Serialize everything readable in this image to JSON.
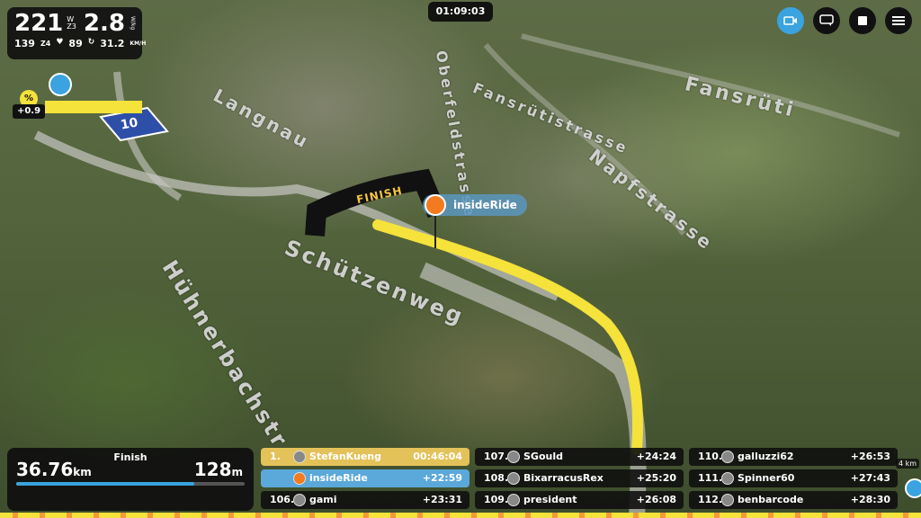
{
  "stats": {
    "power": "221",
    "power_unit": "W",
    "zone": "Z3",
    "wkg": "2.8",
    "wkg_unit": "W/kg",
    "heart_rate": "139",
    "hr_zone": "Z4",
    "cadence": "89",
    "speed": "31.2",
    "speed_unit": "KM/H"
  },
  "grade": {
    "symbol": "%",
    "value": "+0.9"
  },
  "clock": "01:09:03",
  "map": {
    "streets": [
      "Langnau",
      "Oberfeldstrasse",
      "Fansrütistrasse",
      "Fansrüti",
      "Napfstrasse",
      "Schützenweg",
      "Hühnerbachstr"
    ],
    "road_sign": "10",
    "finish_label": "FINISH"
  },
  "rider_label": "insideRide",
  "finish_panel": {
    "title": "Finish",
    "distance": "36.76",
    "distance_unit": "km",
    "elevation": "128",
    "elevation_unit": "m",
    "progress": 0.78
  },
  "leaderboard": {
    "col1": [
      {
        "pos": "1.",
        "name": "StefanKueng",
        "time": "00:46:04"
      },
      {
        "pos": "",
        "name": "insideRide",
        "time": "+22:59"
      },
      {
        "pos": "106.",
        "name": "gami",
        "time": "+23:31"
      }
    ],
    "col2": [
      {
        "pos": "107.",
        "name": "SGould",
        "time": "+24:24"
      },
      {
        "pos": "108.",
        "name": "BixarracusRex",
        "time": "+25:20"
      },
      {
        "pos": "109.",
        "name": "president",
        "time": "+26:08"
      }
    ],
    "col3": [
      {
        "pos": "110.",
        "name": "galluzzi62",
        "time": "+26:53"
      },
      {
        "pos": "111.",
        "name": "Spinner60",
        "time": "+27:43"
      },
      {
        "pos": "112.",
        "name": "benbarcode",
        "time": "+28:30"
      }
    ]
  },
  "edge_badge": "4 km",
  "icons": {
    "camera": "camera-icon",
    "chat": "chat-icon",
    "stop": "stop-icon",
    "menu": "menu-icon"
  },
  "colors": {
    "accent_blue": "#3aa3e0",
    "route_yellow": "#f5e23a",
    "leader_gold": "#e4c25a"
  }
}
